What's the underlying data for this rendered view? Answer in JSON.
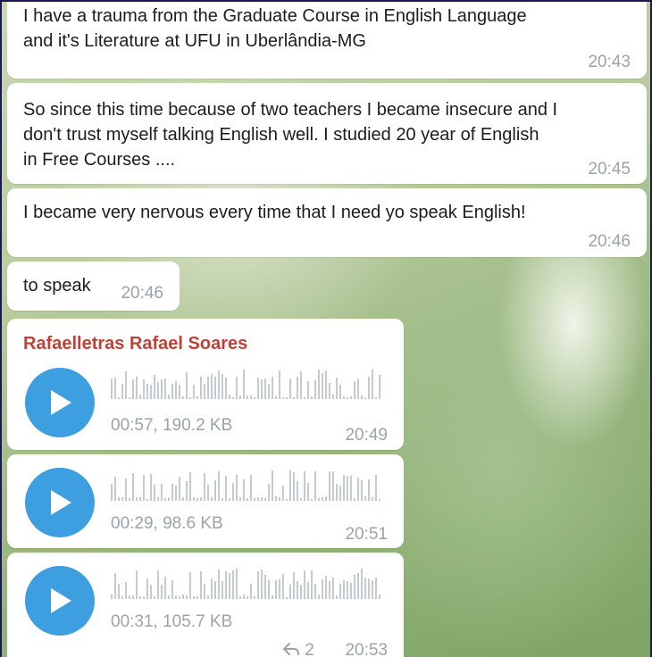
{
  "messages": [
    {
      "text": "I have a trauma from the Graduate Course in English Language\nand it's Literature at UFU in Uberlândia-MG",
      "time": "20:43"
    },
    {
      "text": "So since this time because of two teachers I became insecure and I\ndon't trust myself talking English well. I studied 20 year  of English\nin Free Courses ....",
      "time": "20:45"
    },
    {
      "text": "I became very nervous every time that I need yo speak English!",
      "time": "20:46"
    },
    {
      "text": "to speak",
      "time": "20:46"
    }
  ],
  "sender_name": "Rafaelletras Rafael Soares",
  "voice_messages": [
    {
      "meta": "00:57, 190.2 KB",
      "time": "20:49",
      "icon": "play-icon"
    },
    {
      "meta": "00:29, 98.6 KB",
      "time": "20:51",
      "icon": "play-icon"
    },
    {
      "meta": "00:31, 105.7 KB",
      "time": "20:53",
      "icon": "play-icon",
      "replies": "2",
      "reply_icon": "reply-arrow-icon"
    }
  ],
  "colors": {
    "play_button": "#3e9fe0",
    "sender_name": "#c24136",
    "waveform": "#c3cbd1",
    "timestamp": "#9aa3a9"
  }
}
